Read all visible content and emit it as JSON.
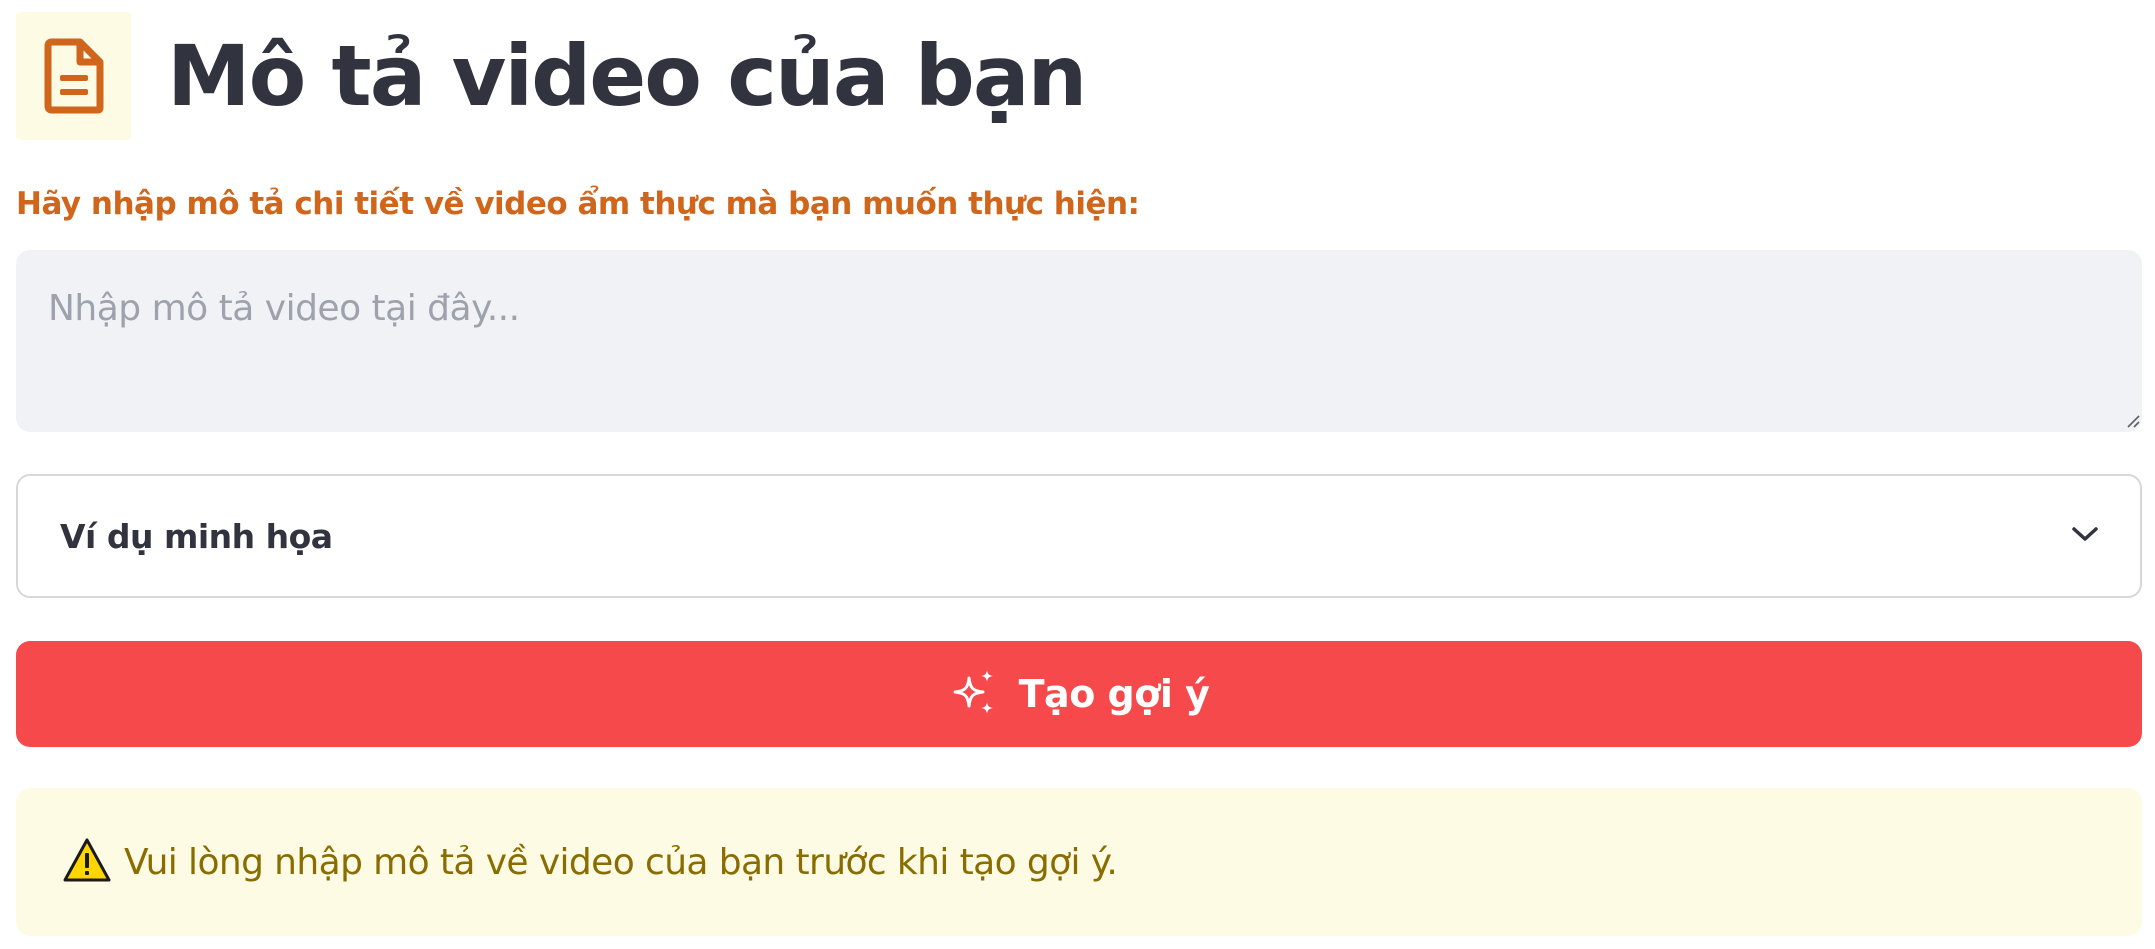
{
  "header": {
    "icon": "document-icon",
    "title": "Mô tả video của bạn"
  },
  "description": {
    "label": "Hãy nhập mô tả chi tiết về video ẩm thực mà bạn muốn thực hiện:",
    "placeholder": "Nhập mô tả video tại đây...",
    "value": ""
  },
  "examples_expander": {
    "label": "Ví dụ minh họa",
    "icon": "chevron-down-icon"
  },
  "generate_button": {
    "label": "Tạo gợi ý",
    "icon": "sparkles-icon"
  },
  "warning": {
    "icon": "warning-icon",
    "text": "Vui lòng nhập mô tả về video của bạn trước khi tạo gợi ý."
  },
  "colors": {
    "accent_orange": "#d0651c",
    "title_text": "#31333f",
    "button_red": "#f5494c",
    "warning_bg": "#fdfbe3",
    "warning_text": "#8a6d00",
    "input_bg": "#f0f2f6"
  }
}
